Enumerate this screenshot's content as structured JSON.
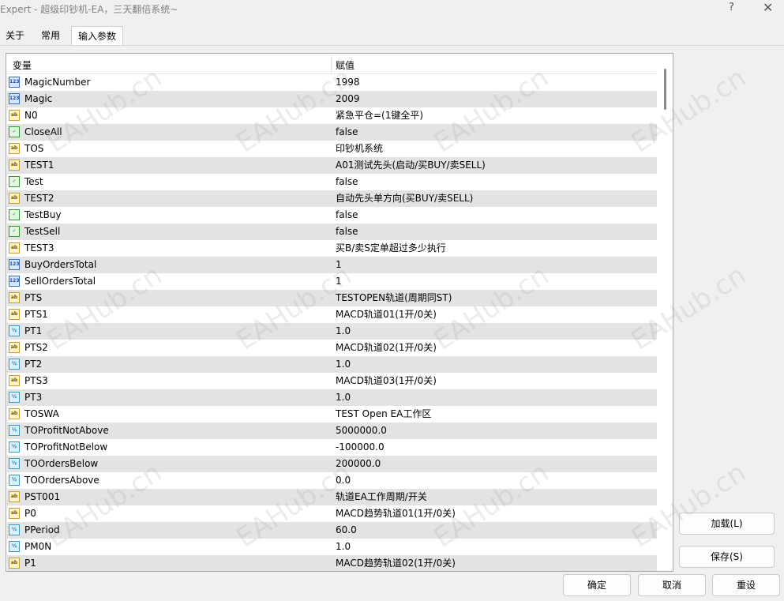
{
  "window": {
    "title": "Expert - 超级印钞机-EA，三天翻倍系统~",
    "help_glyph": "?",
    "close_glyph": "✕"
  },
  "tabs": [
    {
      "label": "关于"
    },
    {
      "label": "常用"
    },
    {
      "label": "输入参数",
      "active": true
    }
  ],
  "grid": {
    "col_name": "变量",
    "col_value": "赋值",
    "rows": [
      {
        "type": "int",
        "icon": "123",
        "name": "MagicNumber",
        "value": "1998"
      },
      {
        "type": "int",
        "icon": "123",
        "name": "Magic",
        "value": "2009"
      },
      {
        "type": "str",
        "icon": "ab",
        "name": "N0",
        "value": "紧急平仓=(1键全平)"
      },
      {
        "type": "bool",
        "icon": "✓",
        "name": "CloseAll",
        "value": "false"
      },
      {
        "type": "str",
        "icon": "ab",
        "name": "TOS",
        "value": "印钞机系统"
      },
      {
        "type": "str",
        "icon": "ab",
        "name": "TEST1",
        "value": "A01测试先头(启动/买BUY/卖SELL)"
      },
      {
        "type": "bool",
        "icon": "✓",
        "name": "Test",
        "value": "false"
      },
      {
        "type": "str",
        "icon": "ab",
        "name": "TEST2",
        "value": "自动先头单方向(买BUY/卖SELL)"
      },
      {
        "type": "bool",
        "icon": "✓",
        "name": "TestBuy",
        "value": "false"
      },
      {
        "type": "bool",
        "icon": "✓",
        "name": "TestSell",
        "value": "false"
      },
      {
        "type": "str",
        "icon": "ab",
        "name": "TEST3",
        "value": "买B/卖S定单超过多少执行"
      },
      {
        "type": "int",
        "icon": "123",
        "name": "BuyOrdersTotal",
        "value": "1"
      },
      {
        "type": "int",
        "icon": "123",
        "name": "SellOrdersTotal",
        "value": "1"
      },
      {
        "type": "str",
        "icon": "ab",
        "name": "PTS",
        "value": "TESTOPEN轨道(周期同ST)"
      },
      {
        "type": "str",
        "icon": "ab",
        "name": "PTS1",
        "value": "MACD轨道01(1开/0关)"
      },
      {
        "type": "dbl",
        "icon": "½",
        "name": "PT1",
        "value": "1.0"
      },
      {
        "type": "str",
        "icon": "ab",
        "name": "PTS2",
        "value": "MACD轨道02(1开/0关)"
      },
      {
        "type": "dbl",
        "icon": "½",
        "name": "PT2",
        "value": "1.0"
      },
      {
        "type": "str",
        "icon": "ab",
        "name": "PTS3",
        "value": "MACD轨道03(1开/0关)"
      },
      {
        "type": "dbl",
        "icon": "½",
        "name": "PT3",
        "value": "1.0"
      },
      {
        "type": "str",
        "icon": "ab",
        "name": "TOSWA",
        "value": "TEST Open EA工作区"
      },
      {
        "type": "dbl",
        "icon": "½",
        "name": "TOProfitNotAbove",
        "value": "5000000.0"
      },
      {
        "type": "dbl",
        "icon": "½",
        "name": "TOProfitNotBelow",
        "value": "-100000.0"
      },
      {
        "type": "dbl",
        "icon": "½",
        "name": "TOOrdersBelow",
        "value": "200000.0"
      },
      {
        "type": "dbl",
        "icon": "½",
        "name": "TOOrdersAbove",
        "value": "0.0"
      },
      {
        "type": "str",
        "icon": "ab",
        "name": "PST001",
        "value": "轨道EA工作周期/开关"
      },
      {
        "type": "str",
        "icon": "ab",
        "name": "P0",
        "value": "MACD趋势轨道01(1开/0关)"
      },
      {
        "type": "dbl",
        "icon": "½",
        "name": "PPeriod",
        "value": "60.0"
      },
      {
        "type": "dbl",
        "icon": "½",
        "name": "PM0N",
        "value": "1.0"
      },
      {
        "type": "str",
        "icon": "ab",
        "name": "P1",
        "value": "MACD趋势轨道02(1开/0关)"
      }
    ]
  },
  "buttons": {
    "load": "加载(L)",
    "save": "保存(S)",
    "ok": "确定",
    "cancel": "取消",
    "reset": "重设"
  },
  "watermark": "EAHub.cn"
}
